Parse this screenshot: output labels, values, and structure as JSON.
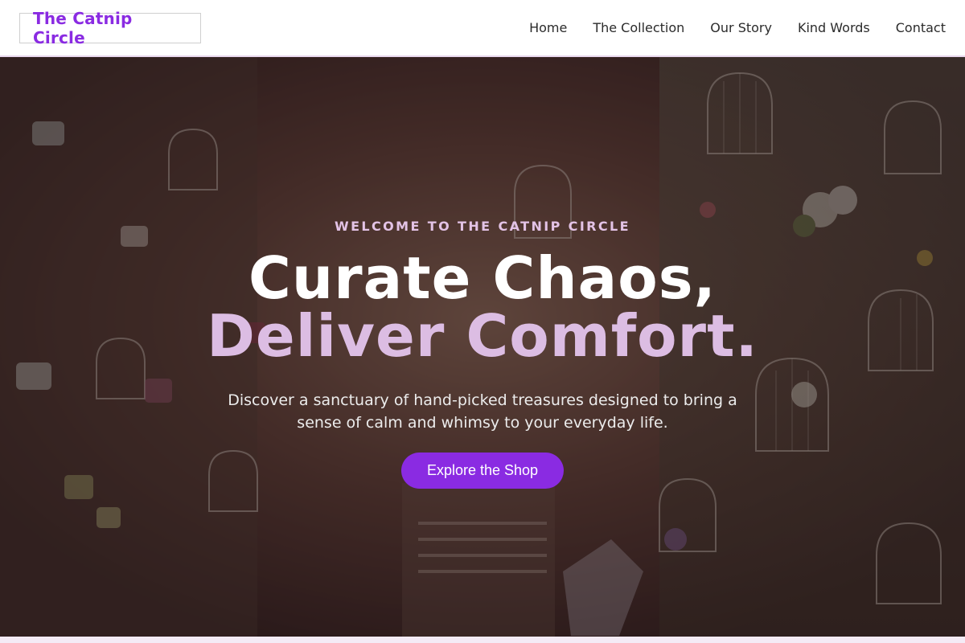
{
  "brand": {
    "name": "The Catnip Circle"
  },
  "nav": {
    "links": [
      {
        "label": "Home"
      },
      {
        "label": "The Collection"
      },
      {
        "label": "Our Story"
      },
      {
        "label": "Kind Words"
      },
      {
        "label": "Contact"
      }
    ]
  },
  "hero": {
    "eyebrow": "WELCOME TO THE CATNIP CIRCLE",
    "headline_line1": "Curate Chaos,",
    "headline_line2": "Deliver Comfort.",
    "description": "Discover a sanctuary of hand-picked treasures designed to bring a sense of calm and whimsy to your everyday life.",
    "cta_label": "Explore the Shop"
  },
  "colors": {
    "brand_purple": "#8a2be2",
    "accent_lavender": "#dcbde3",
    "eyebrow_pink": "#e3c3e6",
    "overlay": "#281619"
  }
}
